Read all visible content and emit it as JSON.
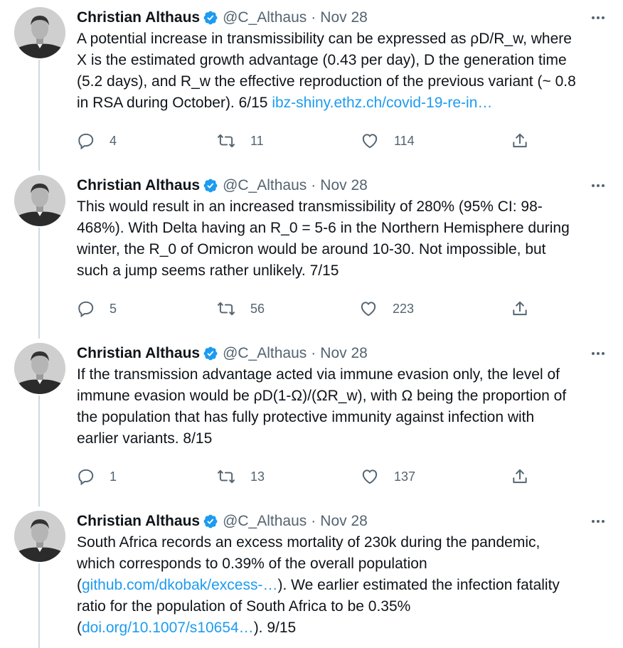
{
  "tweets": [
    {
      "author_name": "Christian Althaus",
      "handle": "@C_Althaus",
      "separator": "·",
      "date": "Nov 28",
      "text_lines": [
        "A potential increase in transmissibility can be expressed as ρD/R_w, where",
        "X is the estimated growth advantage (0.43 per day), D the generation time",
        "(5.2 days), and R_w the effective reproduction of the previous variant (~ 0.8"
      ],
      "last_line_text": "in RSA during October). 6/15 ",
      "link_text": "ibz-shiny.ethz.ch/covid-19-re-in…",
      "replies": "4",
      "retweets": "11",
      "likes": "114"
    },
    {
      "author_name": "Christian Althaus",
      "handle": "@C_Althaus",
      "separator": "·",
      "date": "Nov 28",
      "text_lines": [
        "This would result in an increased transmissibility of 280% (95% CI: 98-",
        "468%). With Delta having an R_0 = 5-6 in the Northern Hemisphere during",
        "winter, the R_0 of Omicron would be around 10-30. Not impossible, but",
        "such a jump seems rather unlikely. 7/15"
      ],
      "replies": "5",
      "retweets": "56",
      "likes": "223"
    },
    {
      "author_name": "Christian Althaus",
      "handle": "@C_Althaus",
      "separator": "·",
      "date": "Nov 28",
      "text_lines": [
        "If the transmission advantage acted via immune evasion only, the level of",
        "immune evasion would be ρD(1-Ω)/(ΩR_w), with Ω being the proportion of",
        "the population that has fully protective immunity against infection with",
        "earlier variants. 8/15"
      ],
      "replies": "1",
      "retweets": "13",
      "likes": "137"
    },
    {
      "author_name": "Christian Althaus",
      "handle": "@C_Althaus",
      "separator": "·",
      "date": "Nov 28",
      "line1": "South Africa records an excess mortality of 230k during the pandemic,",
      "line2": "which corresponds to 0.39% of the overall population",
      "line3_pre": "(",
      "line3_link": "github.com/dkobak/excess-…",
      "line3_post": "). We earlier estimated the infection fatality",
      "line4": "ratio for the population of South Africa to be 0.35%",
      "line5_pre": "(",
      "line5_link": "doi.org/10.1007/s10654…",
      "line5_post": "). 9/15"
    }
  ],
  "colors": {
    "text": "#0f1419",
    "secondary": "#536471",
    "link": "#1d9bf0",
    "verified": "#1d9bf0",
    "thread_line": "#cfd9de"
  },
  "icons": [
    "avatar",
    "verified-badge-icon",
    "more-icon",
    "reply-icon",
    "retweet-icon",
    "like-icon",
    "share-icon"
  ]
}
